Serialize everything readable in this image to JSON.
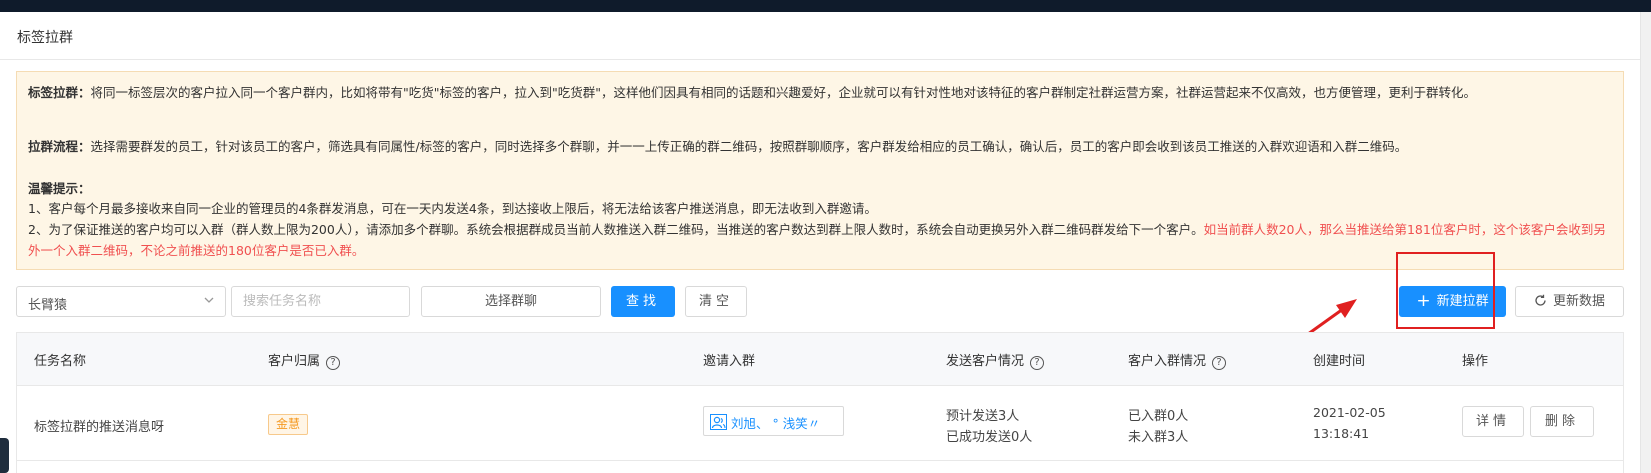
{
  "page": {
    "title": "标签拉群"
  },
  "notice": {
    "intro_label": "标签拉群：",
    "intro_text": "将同一标签层次的客户拉入同一个客户群内，比如将带有\"吃货\"标签的客户，拉入到\"吃货群\"，这样他们因具有相同的话题和兴趣爱好，企业就可以有针对性地对该特征的客户群制定社群运营方案，社群运营起来不仅高效，也方便管理，更利于群转化。",
    "flow_label": "拉群流程：",
    "flow_text": "选择需要群发的员工，针对该员工的客户，筛选具有同属性/标签的客户，同时选择多个群聊，并一一上传正确的群二维码，按照群聊顺序，客户群发给相应的员工确认，确认后，员工的客户即会收到该员工推送的入群欢迎语和入群二维码。",
    "tips_label": "温馨提示：",
    "tip1": "1、客户每个月最多接收来自同一企业的管理员的4条群发消息，可在一天内发送4条，到达接收上限后，将无法给该客户推送消息，即无法收到入群邀请。",
    "tip2": "2、为了保证推送的客户均可以入群（群人数上限为200人），请添加多个群聊。系统会根据群成员当前人数推送入群二维码，当推送的客户数达到群上限人数时，系统会自动更换另外入群二维码群发给下一个客户。",
    "tip2_red": "如当前群人数20人，那么当推送给第181位客户时，这个该客户会收到另外一个入群二维码，不论之前推送的180位客户是否已入群。"
  },
  "filters": {
    "employee_value": "长臂猿",
    "search_placeholder": "搜索任务名称",
    "group_select_label": "选择群聊",
    "find_label": "查找",
    "clear_label": "清空",
    "new_label": "新建拉群",
    "refresh_label": "更新数据"
  },
  "table": {
    "headers": {
      "task_name": "任务名称",
      "owner": "客户归属",
      "invite": "邀请入群",
      "send_status": "发送客户情况",
      "join_status": "客户入群情况",
      "created": "创建时间",
      "actions": "操作"
    },
    "rows": [
      {
        "task_name": "标签拉群的推送消息呀",
        "owner_tag": "金慧",
        "invite_text": "刘旭、 ° 浅笑〃",
        "send_plan": "预计发送3人",
        "send_done": "已成功发送0人",
        "joined": "已入群0人",
        "not_joined": "未入群3人",
        "created_date": "2021-02-05",
        "created_time": "13:18:41",
        "detail_label": "详情",
        "delete_label": "删除"
      }
    ]
  },
  "colors": {
    "primary": "#1890ff",
    "notice_bg": "#fef6e6",
    "warn_red": "#f05050",
    "annotation_red": "#e02020",
    "tag_orange": "#f59a23"
  }
}
